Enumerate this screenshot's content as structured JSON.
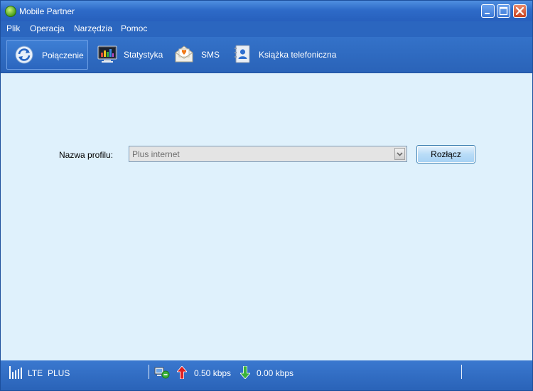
{
  "window": {
    "title": "Mobile Partner"
  },
  "menu": [
    "Plik",
    "Operacja",
    "Narzędzia",
    "Pomoc"
  ],
  "toolbar": [
    {
      "label": "Połączenie",
      "icon": "refresh-icon",
      "active": true
    },
    {
      "label": "Statystyka",
      "icon": "monitor-chart-icon",
      "active": false
    },
    {
      "label": "SMS",
      "icon": "envelope-icon",
      "active": false
    },
    {
      "label": "Książka telefoniczna",
      "icon": "phonebook-icon",
      "active": false
    }
  ],
  "connection": {
    "profile_label": "Nazwa profilu:",
    "profile_value": "Plus internet",
    "disconnect_label": "Rozłącz"
  },
  "status": {
    "network": "LTE",
    "operator": "PLUS",
    "upload": "0.50 kbps",
    "download": "0.00 kbps"
  },
  "colors": {
    "chrome_blue": "#2a63b8",
    "content_bg": "#dff1fc",
    "upload_arrow": "#e02020",
    "download_arrow": "#3ab23a"
  }
}
